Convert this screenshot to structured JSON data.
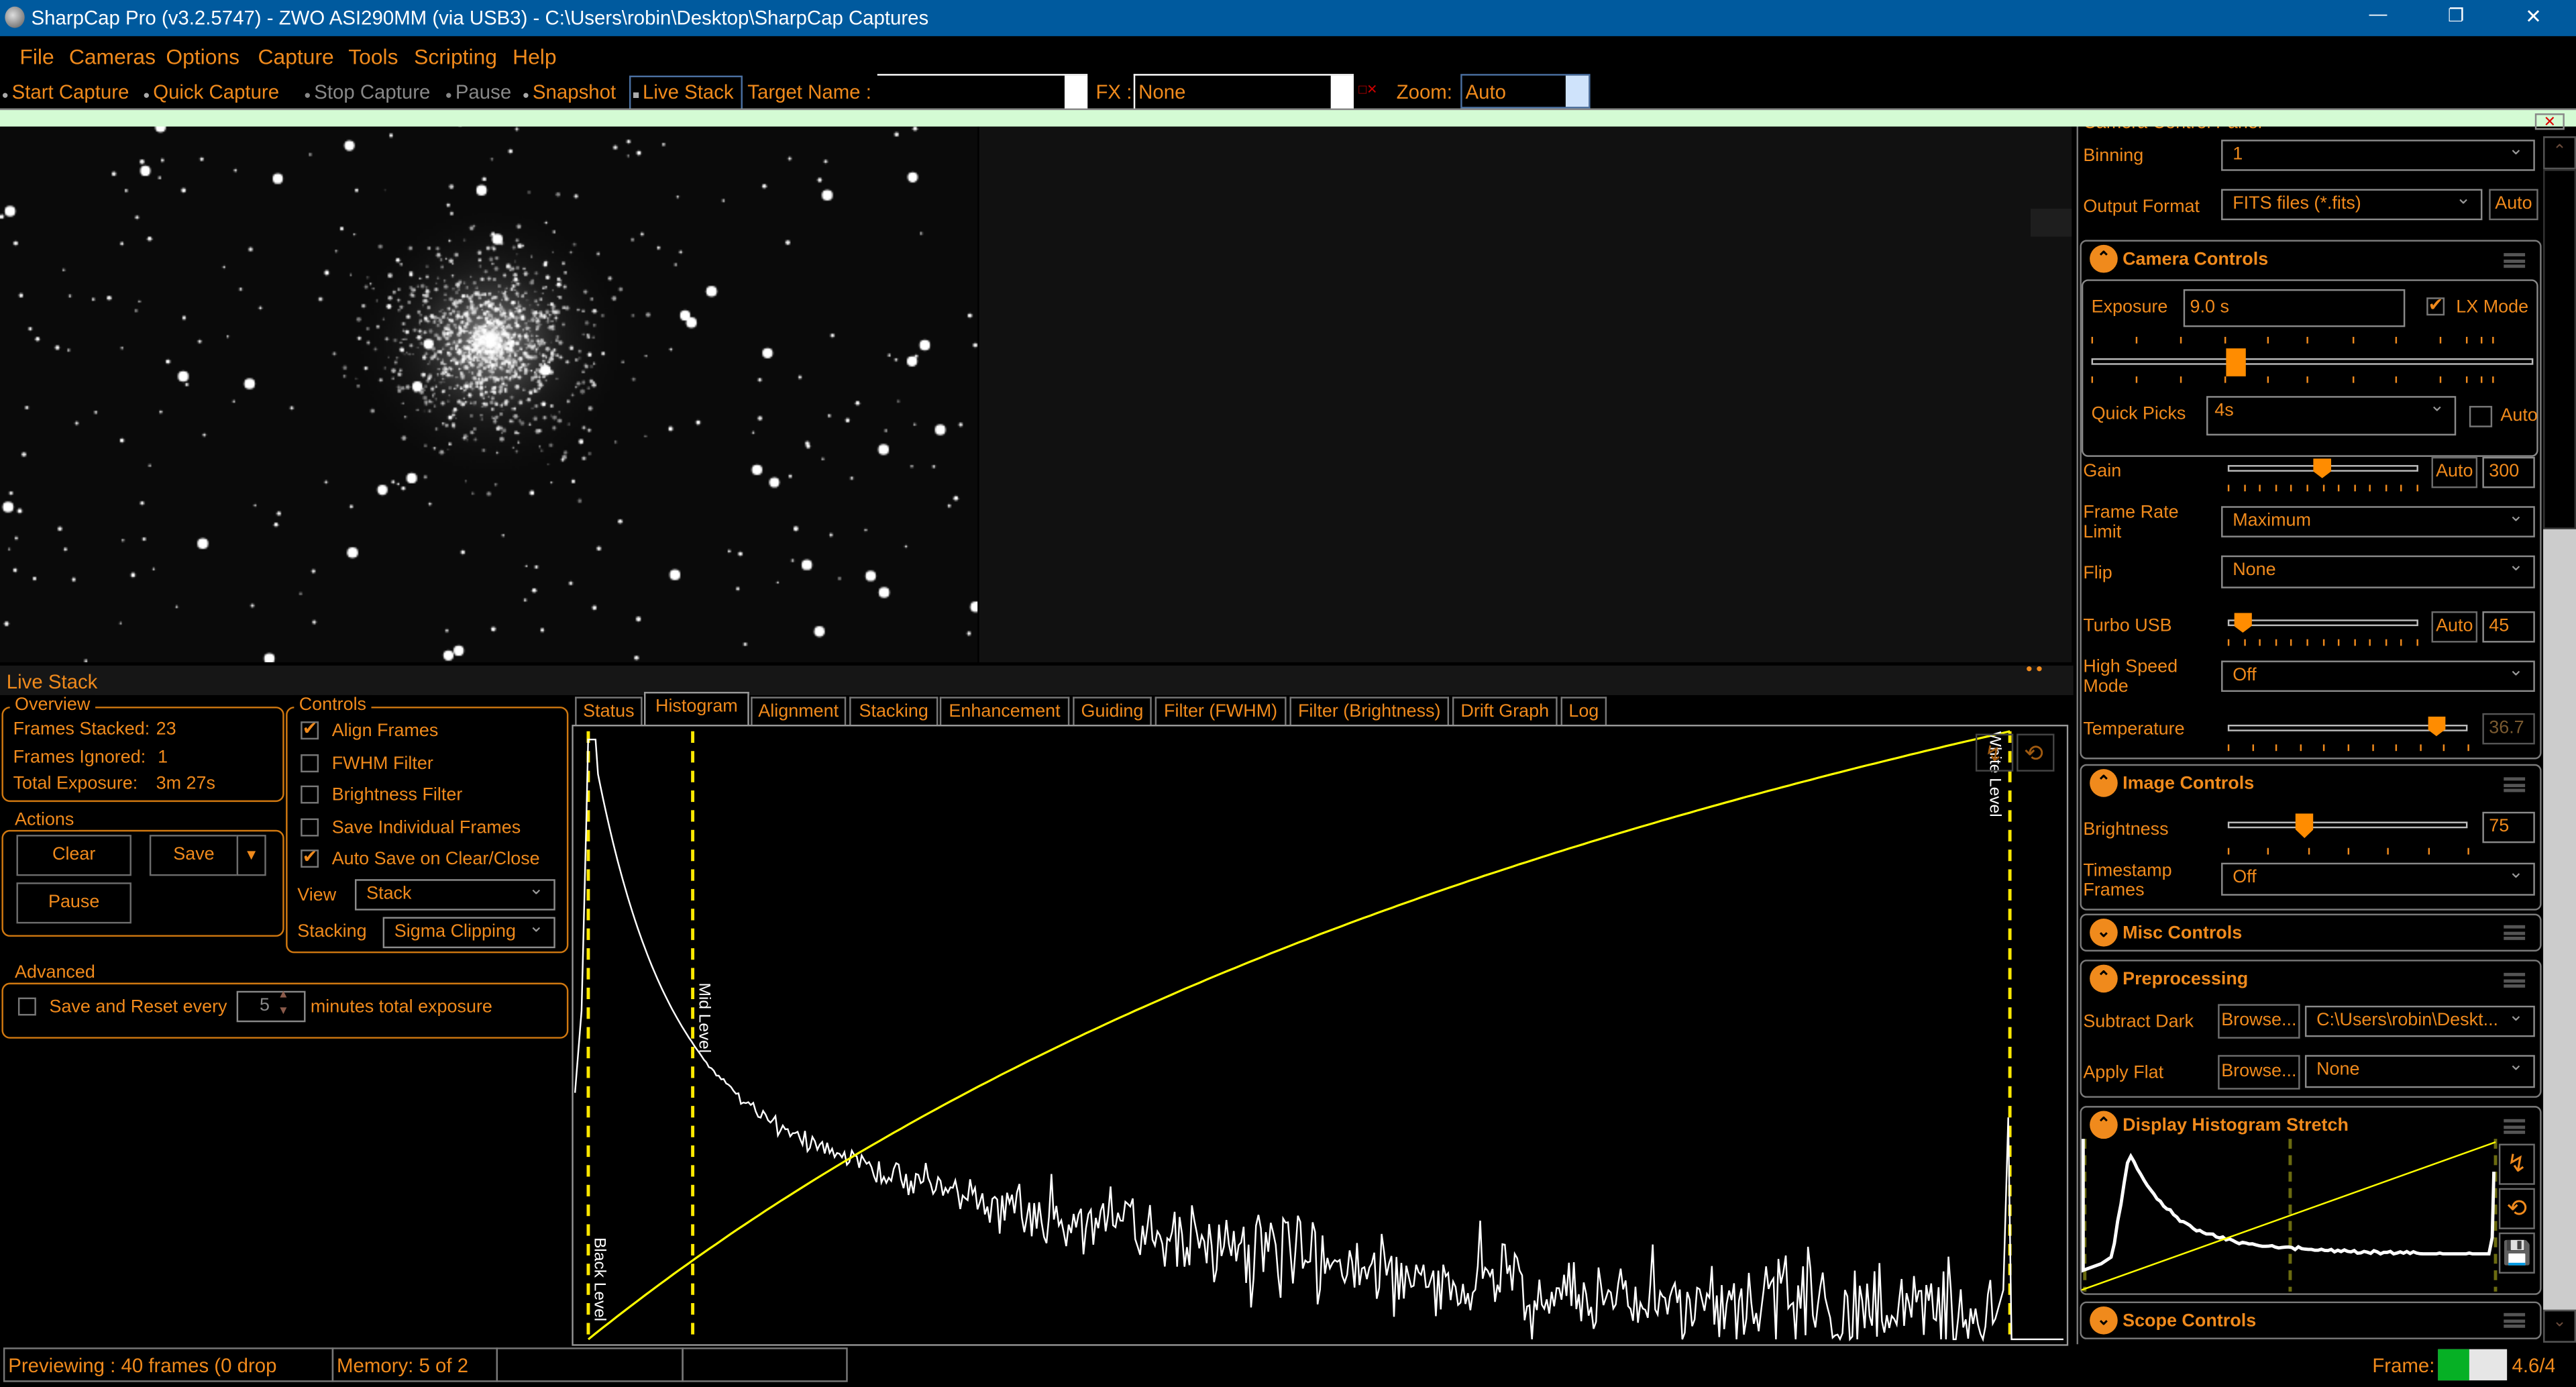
{
  "window": {
    "title": "SharpCap Pro (v3.2.5747) - ZWO ASI290MM (via USB3) - C:\\Users\\robin\\Desktop\\SharpCap Captures",
    "minimize": "—",
    "restore": "❐",
    "close": "✕"
  },
  "menu": [
    "File",
    "Cameras",
    "Options",
    "Capture",
    "Tools",
    "Scripting",
    "Help"
  ],
  "toolbar": {
    "start_capture": "Start Capture",
    "quick_capture": "Quick Capture",
    "stop_capture": "Stop Capture",
    "pause": "Pause",
    "snapshot": "Snapshot",
    "live_stack": "Live Stack",
    "target_name_label": "Target Name :",
    "target_name_value": "",
    "fx_label": "FX :",
    "fx_value": "None",
    "zoom_label": "Zoom:",
    "zoom_value": "Auto"
  },
  "camera_panel": {
    "title": "Camera Control Panel",
    "binning": {
      "label": "Binning",
      "value": "1"
    },
    "output_format": {
      "label": "Output Format",
      "value": "FITS files (*.fits)",
      "auto": "Auto"
    },
    "camera_controls": {
      "title": "Camera Controls",
      "exposure": {
        "label": "Exposure",
        "value": "9.0 s",
        "slider_fraction": 0.33
      },
      "lx_mode": {
        "label": "LX Mode",
        "checked": true
      },
      "quick_picks": {
        "label": "Quick Picks",
        "value": "4s",
        "auto": "Auto"
      },
      "gain": {
        "label": "Gain",
        "auto": "Auto",
        "value": "300",
        "slider_fraction": 0.5
      },
      "frame_rate_limit": {
        "label": "Frame Rate Limit",
        "value": "Maximum"
      },
      "flip": {
        "label": "Flip",
        "value": "None"
      },
      "turbo_usb": {
        "label": "Turbo USB",
        "auto": "Auto",
        "value": "45",
        "slider_fraction": 0.08
      },
      "high_speed_mode": {
        "label": "High Speed Mode",
        "value": "Off"
      },
      "temperature": {
        "label": "Temperature",
        "value": "36.7",
        "slider_fraction": 0.87
      }
    },
    "image_controls": {
      "title": "Image Controls",
      "brightness": {
        "label": "Brightness",
        "value": "75",
        "slider_fraction": 0.32
      },
      "timestamp_frames": {
        "label": "Timestamp Frames",
        "value": "Off"
      }
    },
    "misc_controls": {
      "title": "Misc Controls"
    },
    "preprocessing": {
      "title": "Preprocessing",
      "subtract_dark": {
        "label": "Subtract Dark",
        "browse": "Browse...",
        "value": "C:\\Users\\robin\\Deskt..."
      },
      "apply_flat": {
        "label": "Apply Flat",
        "browse": "Browse...",
        "value": "None"
      }
    },
    "display_histogram_stretch": {
      "title": "Display Histogram Stretch"
    },
    "scope_controls": {
      "title": "Scope Controls"
    }
  },
  "live_stack": {
    "title": "Live Stack",
    "overview": {
      "legend": "Overview",
      "frames_stacked_label": "Frames Stacked:",
      "frames_stacked": "23",
      "frames_ignored_label": "Frames Ignored:",
      "frames_ignored": "1",
      "total_exposure_label": "Total Exposure:",
      "total_exposure": "3m 27s"
    },
    "actions": {
      "legend": "Actions",
      "clear": "Clear",
      "save": "Save",
      "pause": "Pause"
    },
    "controls": {
      "legend": "Controls",
      "checkboxes": [
        {
          "label": "Align Frames",
          "checked": true
        },
        {
          "label": "FWHM Filter",
          "checked": false
        },
        {
          "label": "Brightness Filter",
          "checked": false
        },
        {
          "label": "Save Individual Frames",
          "checked": false
        },
        {
          "label": "Auto Save on Clear/Close",
          "checked": true
        }
      ],
      "view_label": "View",
      "view_value": "Stack",
      "stacking_label": "Stacking",
      "stacking_value": "Sigma Clipping"
    },
    "advanced": {
      "legend": "Advanced",
      "save_reset_label": "Save and Reset every",
      "minutes_value": "5",
      "minutes_suffix": "minutes total exposure",
      "checked": false
    },
    "tabs": [
      "Status",
      "Histogram",
      "Alignment",
      "Stacking",
      "Enhancement",
      "Guiding",
      "Filter (FWHM)",
      "Filter (Brightness)",
      "Drift Graph",
      "Log"
    ],
    "active_tab": "Histogram",
    "histogram": {
      "black_level_label": "Black Level",
      "mid_level_label": "Mid Level",
      "white_level_label": "White Level",
      "black_level": 0.01,
      "mid_level": 0.08,
      "white_level": 0.963,
      "curve_color": "#ffff00",
      "histogram_color": "#ffffff"
    }
  },
  "status_bar": {
    "previewing": "Previewing : 40 frames (0 drop",
    "memory": "Memory: 5 of 2",
    "frame_label": "Frame:",
    "frame_value": "4.6/4",
    "frame_fill": 0.45
  },
  "colors": {
    "accent": "#f08a1c",
    "title_bar": "#005a9e",
    "notification": "#d4fbd4"
  }
}
